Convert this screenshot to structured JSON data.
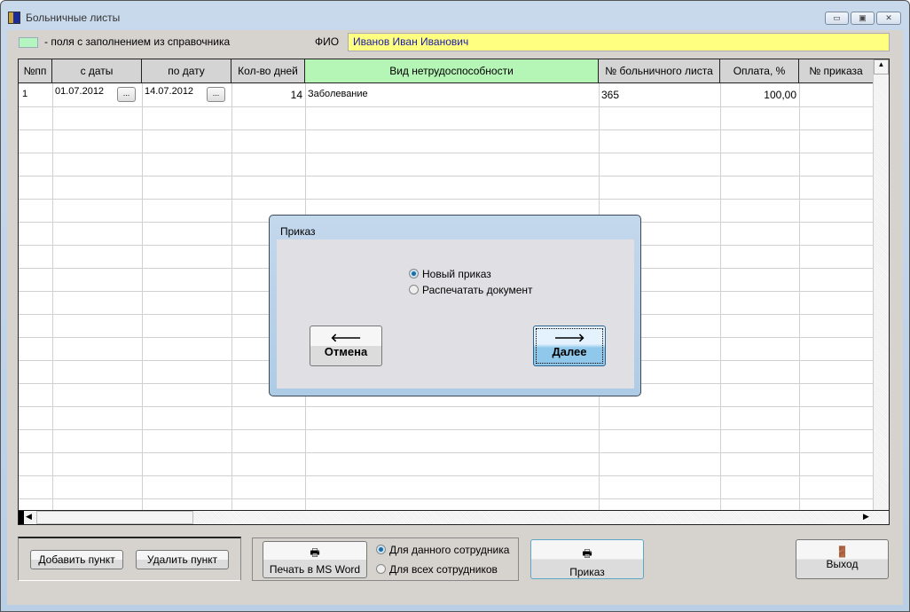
{
  "window": {
    "title": "Больничные листы",
    "controls": [
      "minimize",
      "maximize",
      "close"
    ]
  },
  "legend": {
    "text": "- поля с заполнением из справочника",
    "color": "#b5f5c0"
  },
  "fio": {
    "label": "ФИО",
    "value": "Иванов Иван Иванович"
  },
  "table": {
    "columns": [
      "№пп",
      "с даты",
      "по дату",
      "Кол-во дней",
      "Вид нетрудоспособности",
      "№ больничного листа",
      "Оплата, %",
      "№ приказа"
    ],
    "rows": [
      {
        "num": "1",
        "from": "01.07.2012",
        "to": "14.07.2012",
        "days": "14",
        "type": "Заболевание",
        "sheet_no": "365",
        "payment": "100,00",
        "order_no": ""
      }
    ],
    "date_button": "..."
  },
  "buttons": {
    "add": "Добавить пункт",
    "delete": "Удалить пункт",
    "print_word": "Печать в MS Word",
    "order": "Приказ",
    "exit": "Выход"
  },
  "print_scope": {
    "options": [
      "Для данного сотрудника",
      "Для всех сотрудников"
    ],
    "selected": 0
  },
  "dialog": {
    "title": "Приказ",
    "options": [
      "Новый приказ",
      "Распечатать документ"
    ],
    "selected": 0,
    "cancel": "Отмена",
    "next": "Далее"
  }
}
